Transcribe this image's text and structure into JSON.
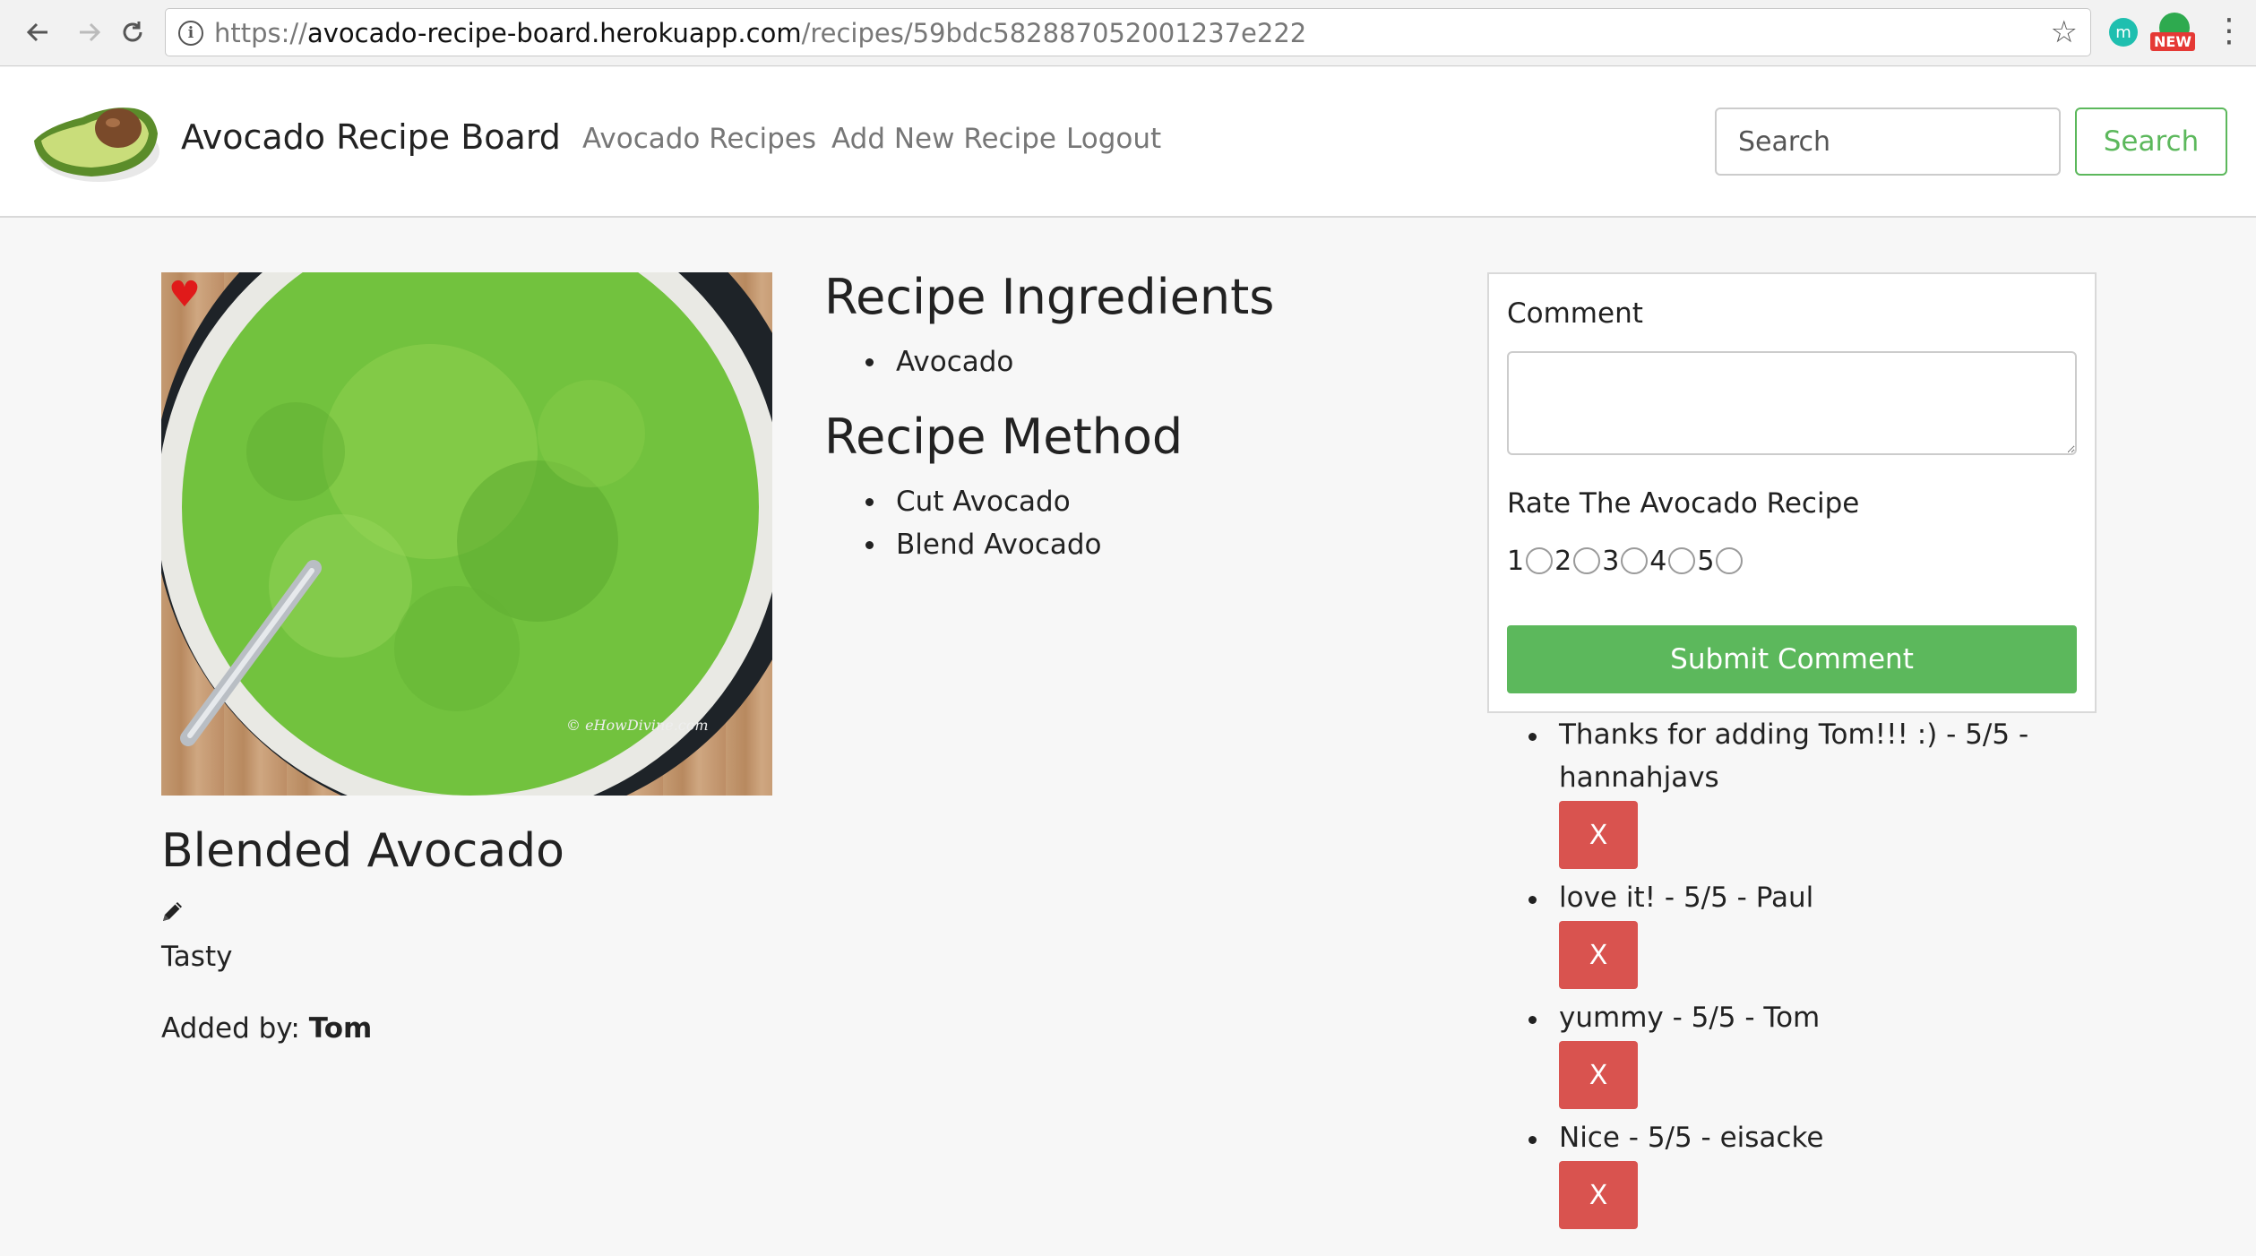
{
  "browser": {
    "url_prefix": "https://",
    "url_host": "avocado-recipe-board.herokuapp.com",
    "url_path": "/recipes/59bdc582887052001237e222",
    "extension_m_label": "m",
    "extension_new_badge": "NEW",
    "icons": {
      "back": "arrow-left",
      "forward": "arrow-right",
      "reload": "reload",
      "info": "info",
      "bookmark": "star",
      "menu": "kebab"
    }
  },
  "navbar": {
    "brand": "Avocado Recipe Board",
    "links": [
      "Avocado Recipes",
      "Add New Recipe",
      "Logout"
    ],
    "search_placeholder": "Search",
    "search_button": "Search"
  },
  "recipe": {
    "watermark": "© eHowDivine.com",
    "title": "Blended Avocado",
    "description": "Tasty",
    "added_by_label": "Added by:",
    "added_by_user": "Tom",
    "favorite_color": "#e01a1a",
    "ingredients_title": "Recipe Ingredients",
    "ingredients": [
      "Avocado"
    ],
    "method_title": "Recipe Method",
    "method": [
      "Cut Avocado",
      "Blend Avocado"
    ]
  },
  "comment_form": {
    "comment_label": "Comment",
    "rate_label": "Rate The Avocado Recipe",
    "ratings": [
      "1",
      "2",
      "3",
      "4",
      "5"
    ],
    "submit_label": "Submit Comment"
  },
  "comments": [
    {
      "text": "Thanks for adding Tom!!! :) - 5/5 - hannahjavs",
      "delete_label": "X"
    },
    {
      "text": "love it! - 5/5 - Paul",
      "delete_label": "X"
    },
    {
      "text": "yummy - 5/5 - Tom",
      "delete_label": "X"
    },
    {
      "text": "Nice - 5/5 - eisacke",
      "delete_label": "X"
    }
  ],
  "colors": {
    "success": "#5cb85c",
    "danger": "#d9534f",
    "heart": "#e01a1a"
  }
}
